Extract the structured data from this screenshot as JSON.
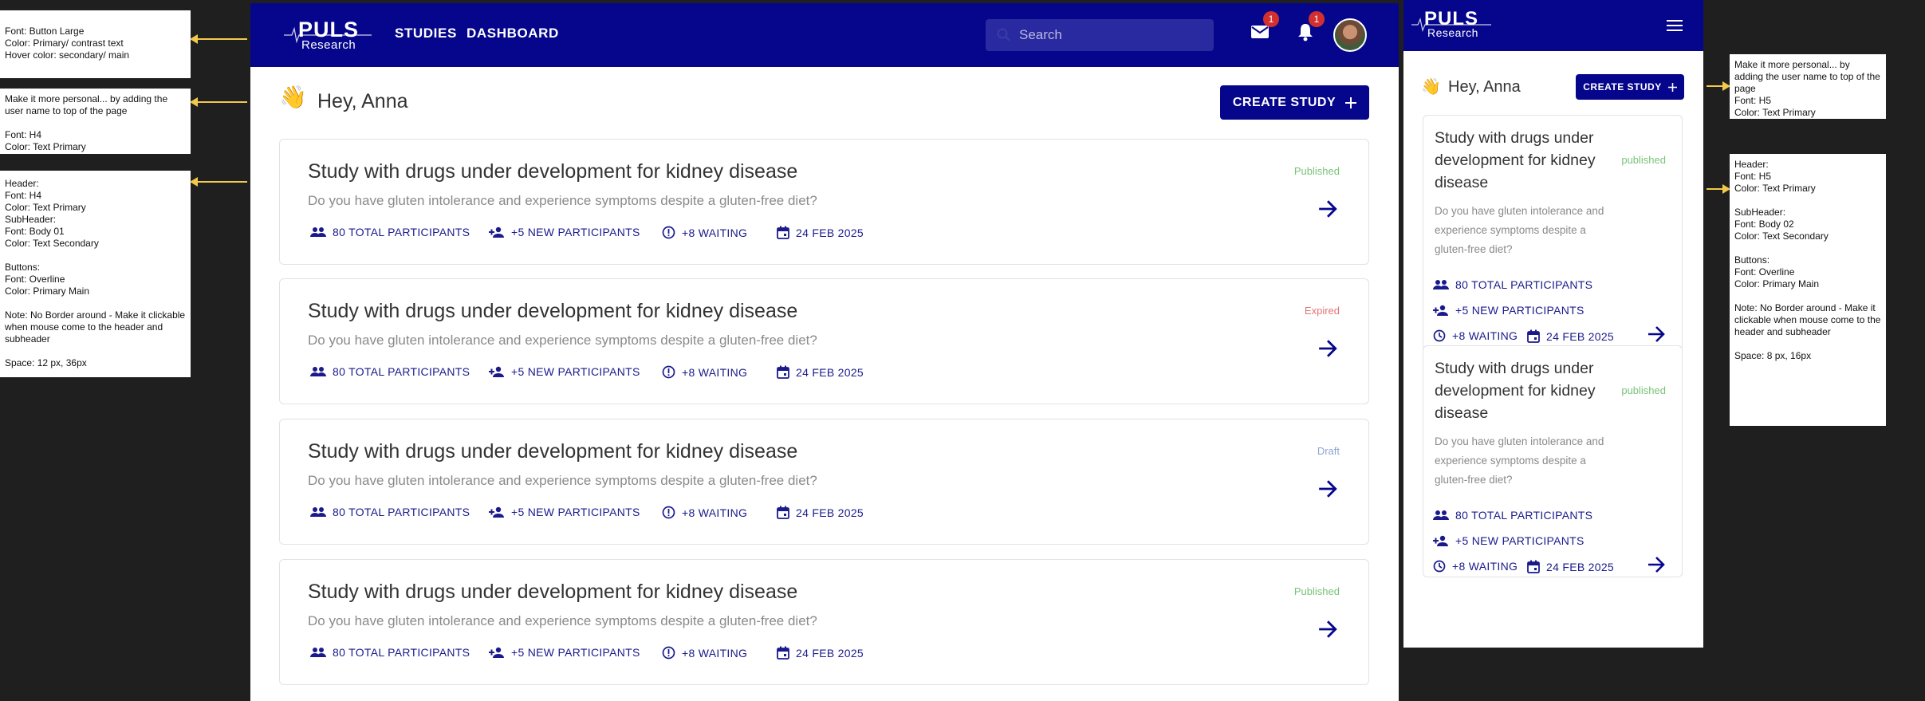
{
  "annotations": {
    "button_note": [
      "Font: Button Large",
      "Color: Primary/ contrast text",
      "Hover color: secondary/ main"
    ],
    "greeting_note": [
      "Make it more personal... by adding the user name to top of the page",
      "",
      "Font: H4",
      "Color: Text Primary"
    ],
    "card_note": [
      "Header:",
      "Font: H4",
      "Color: Text Primary",
      "SubHeader:",
      "Font: Body 01",
      "Color: Text Secondary",
      "",
      "Buttons:",
      "Font: Overline",
      "Color: Primary Main",
      "",
      "Note: No Border around - Make it clickable when mouse come to the header and subheader",
      "",
      "Space: 12 px, 36px"
    ],
    "mobile_greeting_note": [
      "Make it more personal... by adding the user name to top of the page",
      "Font: H5",
      "Color: Text Primary"
    ],
    "mobile_card_note": [
      "Header:",
      "Font: H5",
      "Color: Text Primary",
      "",
      "SubHeader:",
      "Font: Body 02",
      "Color: Text Secondary",
      "",
      "Buttons:",
      "Font: Overline",
      "Color: Primary Main",
      "",
      "Note: No Border around - Make it clickable when mouse come to the header and subheader",
      "",
      "Space: 8 px, 16px"
    ]
  },
  "brand": {
    "name": "PULS",
    "sub": "Research"
  },
  "nav": {
    "studies": "STUDIES",
    "dashboard": "DASHBOARD"
  },
  "search": {
    "placeholder": "Search"
  },
  "badges": {
    "mail": "1",
    "notifications": "1"
  },
  "greeting": {
    "emoji": "👋",
    "text": "Hey, Anna"
  },
  "create_button": "CREATE STUDY",
  "colors": {
    "primary": "#06068c",
    "published": "#7ac27a",
    "expired": "#e57373",
    "draft": "#90a4d4"
  },
  "studies": [
    {
      "title": "Study with drugs under development for kidney disease",
      "subtitle": "Do you have gluten intolerance and experience symptoms despite a gluten-free diet?",
      "status": "Published",
      "participants": "80 TOTAL PARTICIPANTS",
      "new": "+5 NEW PARTICIPANTS",
      "waiting": "+8 WAITING",
      "date": "24 FEB 2025"
    },
    {
      "title": "Study with drugs under development for kidney disease",
      "subtitle": "Do you have gluten intolerance and experience symptoms despite a gluten-free diet?",
      "status": "Expired",
      "participants": "80 TOTAL PARTICIPANTS",
      "new": "+5 NEW PARTICIPANTS",
      "waiting": "+8 WAITING",
      "date": "24 FEB 2025"
    },
    {
      "title": "Study with drugs under development for kidney disease",
      "subtitle": "Do you have gluten intolerance and experience symptoms despite a gluten-free diet?",
      "status": "Draft",
      "participants": "80 TOTAL PARTICIPANTS",
      "new": "+5 NEW PARTICIPANTS",
      "waiting": "+8 WAITING",
      "date": "24 FEB 2025"
    },
    {
      "title": "Study with drugs under development for kidney disease",
      "subtitle": "Do you have gluten intolerance and experience symptoms despite a gluten-free diet?",
      "status": "Published",
      "participants": "80 TOTAL PARTICIPANTS",
      "new": "+5 NEW PARTICIPANTS",
      "waiting": "+8 WAITING",
      "date": "24 FEB 2025"
    }
  ],
  "mobile_studies": [
    {
      "title": "Study with drugs under development for kidney disease",
      "subtitle": "Do you have gluten intolerance and experience symptoms despite a gluten-free diet?",
      "status": "published",
      "participants": "80 TOTAL PARTICIPANTS",
      "new": "+5 NEW PARTICIPANTS",
      "waiting": "+8 WAITING",
      "date": "24 FEB 2025"
    },
    {
      "title": "Study with drugs under development for kidney disease",
      "subtitle": "Do you have gluten intolerance and experience symptoms despite a gluten-free diet?",
      "status": "published",
      "participants": "80 TOTAL PARTICIPANTS",
      "new": "+5 NEW PARTICIPANTS",
      "waiting": "+8 WAITING",
      "date": "24 FEB 2025"
    }
  ]
}
